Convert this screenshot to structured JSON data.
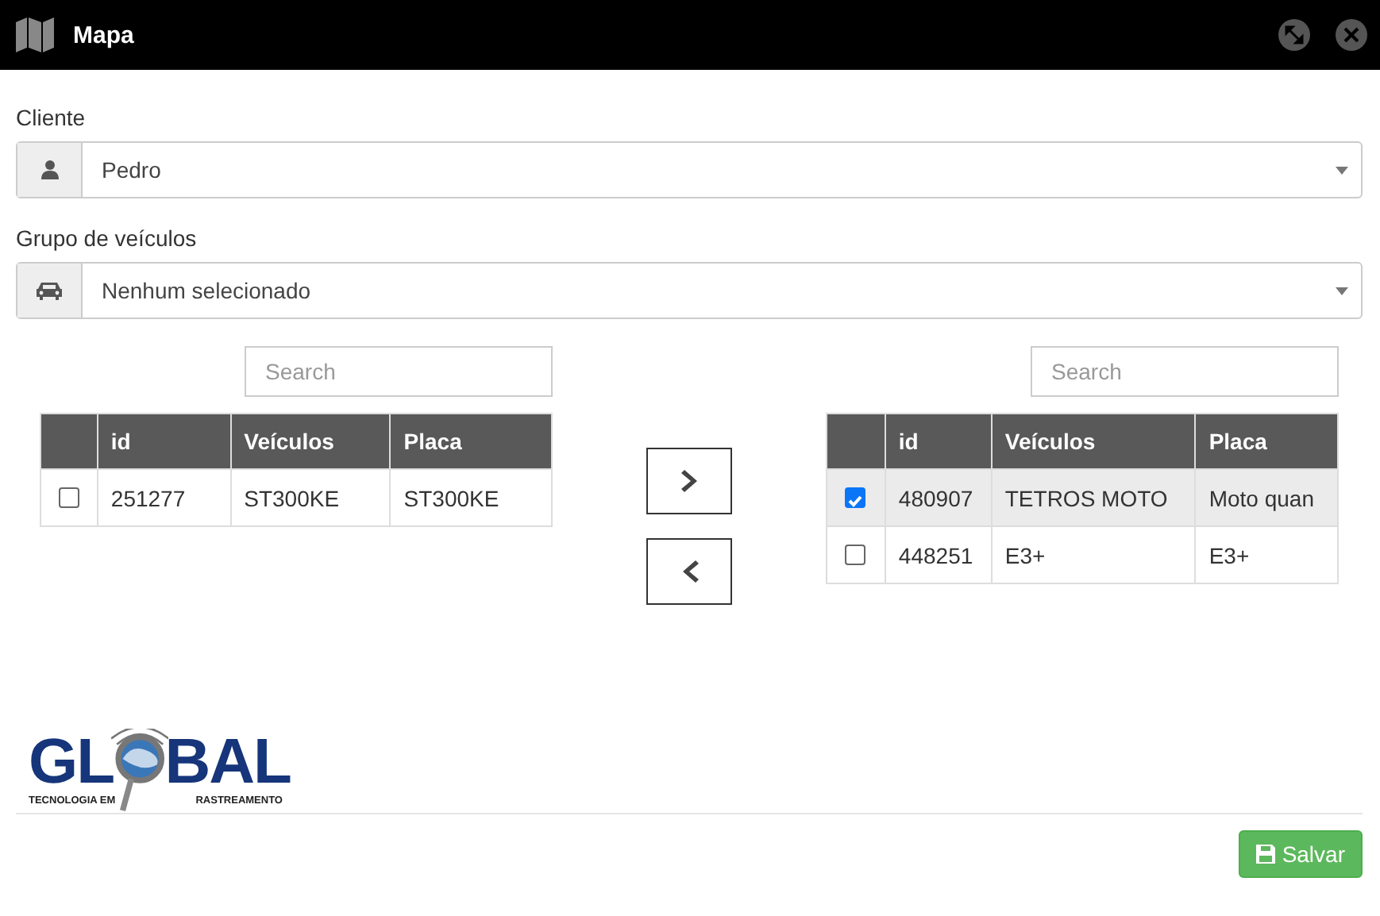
{
  "window": {
    "title": "Mapa"
  },
  "fields": [
    {
      "label": "Cliente",
      "kind": "person",
      "value": "Pedro"
    },
    {
      "label": "Grupo de veículos",
      "kind": "car",
      "value": "Nenhum selecionado"
    }
  ],
  "lists": [
    {
      "search": {
        "placeholder": "Search"
      },
      "columns": [
        "id",
        "Veículos",
        "Placa"
      ],
      "rows": [
        {
          "checked": false,
          "selected": false,
          "cells": [
            "251277",
            "ST300KE",
            "ST300KE"
          ]
        }
      ]
    },
    {
      "search": {
        "placeholder": "Search"
      },
      "columns": [
        "id",
        "Veículos",
        "Placa"
      ],
      "rows": [
        {
          "checked": true,
          "selected": true,
          "cells": [
            "480907",
            "TETROS MOTO",
            "Moto quan"
          ]
        },
        {
          "checked": false,
          "selected": false,
          "cells": [
            "448251",
            "E3+",
            "E3+"
          ]
        }
      ]
    }
  ],
  "transfer_buttons": [
    {
      "kind": "right"
    },
    {
      "kind": "left"
    }
  ],
  "logo": {
    "word_start": "GL",
    "word_end": "BAL",
    "tagline_start": "TECNOLOGIA EM",
    "tagline_end": "RASTREAMENTO"
  },
  "save_button": {
    "label": "Salvar"
  }
}
